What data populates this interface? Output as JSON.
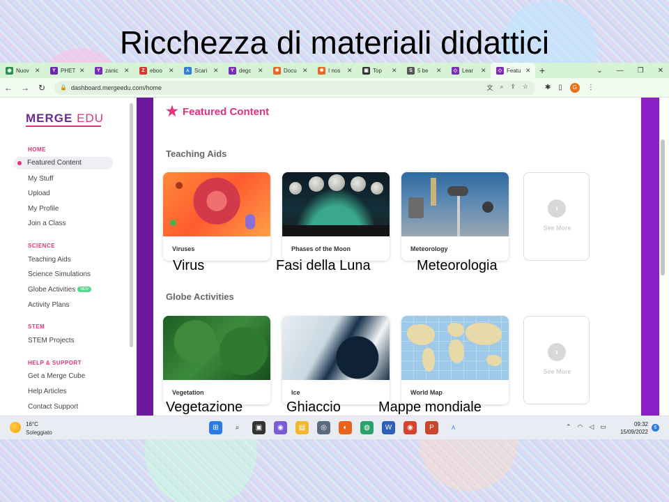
{
  "slide": {
    "title": "Ricchezza di materiali didattici"
  },
  "browser": {
    "tabs": [
      {
        "label": "Nuov",
        "color": "#2d8f4e",
        "glyph": "◉"
      },
      {
        "label": "PHET",
        "color": "#6a2aa8",
        "glyph": "Y"
      },
      {
        "label": "zanic",
        "color": "#7b2db6",
        "glyph": "Y"
      },
      {
        "label": "eboo",
        "color": "#d63a2f",
        "glyph": "Z"
      },
      {
        "label": "Scari",
        "color": "#3a7bd5",
        "glyph": "⋏"
      },
      {
        "label": "degc",
        "color": "#7b2db6",
        "glyph": "Y"
      },
      {
        "label": "Docu",
        "color": "#e06a2a",
        "glyph": "✱"
      },
      {
        "label": "I nos",
        "color": "#e06a2a",
        "glyph": "✱"
      },
      {
        "label": "Top",
        "color": "#333333",
        "glyph": "▣"
      },
      {
        "label": "5 be",
        "color": "#555555",
        "glyph": "S"
      },
      {
        "label": "Lear",
        "color": "#7b2db6",
        "glyph": "◇"
      },
      {
        "label": "Featu",
        "color": "#7b2db6",
        "glyph": "◇",
        "active": true
      }
    ],
    "url": "dashboard.mergeedu.com/home",
    "profile_initial": "G"
  },
  "sidebar": {
    "logo_main": "MERGE",
    "logo_edu": "EDU",
    "sections": [
      {
        "title": "HOME"
      },
      {
        "title": "SCIENCE"
      },
      {
        "title": "STEM"
      },
      {
        "title": "HELP & SUPPORT"
      }
    ],
    "items": {
      "featured": "Featured Content",
      "mystuff": "My Stuff",
      "upload": "Upload",
      "profile": "My Profile",
      "join": "Join a Class",
      "aids": "Teaching Aids",
      "sims": "Science Simulations",
      "globe": "Globe Activities",
      "globe_badge": "NEW",
      "plans": "Activity Plans",
      "stem": "STEM Projects",
      "cube": "Get a Merge Cube",
      "help": "Help Articles",
      "contact": "Contact Support"
    }
  },
  "main": {
    "header": "Featured Content",
    "teaching_aids": {
      "title": "Teaching Aids",
      "cards": [
        {
          "label": "Viruses",
          "caption": "Virus"
        },
        {
          "label": "Phases of the Moon",
          "caption": "Fasi della Luna"
        },
        {
          "label": "Meteorology",
          "caption": "Meteorologia"
        }
      ]
    },
    "globe_activities": {
      "title": "Globe Activities",
      "cards": [
        {
          "label": "Vegetation",
          "caption": "Vegetazione"
        },
        {
          "label": "Ice",
          "caption": "Ghiaccio"
        },
        {
          "label": "World Map",
          "caption": "Mappe mondiale"
        }
      ]
    },
    "see_more": "See More"
  },
  "taskbar": {
    "temperature": "16°C",
    "weather": "Soleggiato",
    "time": "09:32",
    "date": "15/09/2022",
    "notifications": "6"
  }
}
